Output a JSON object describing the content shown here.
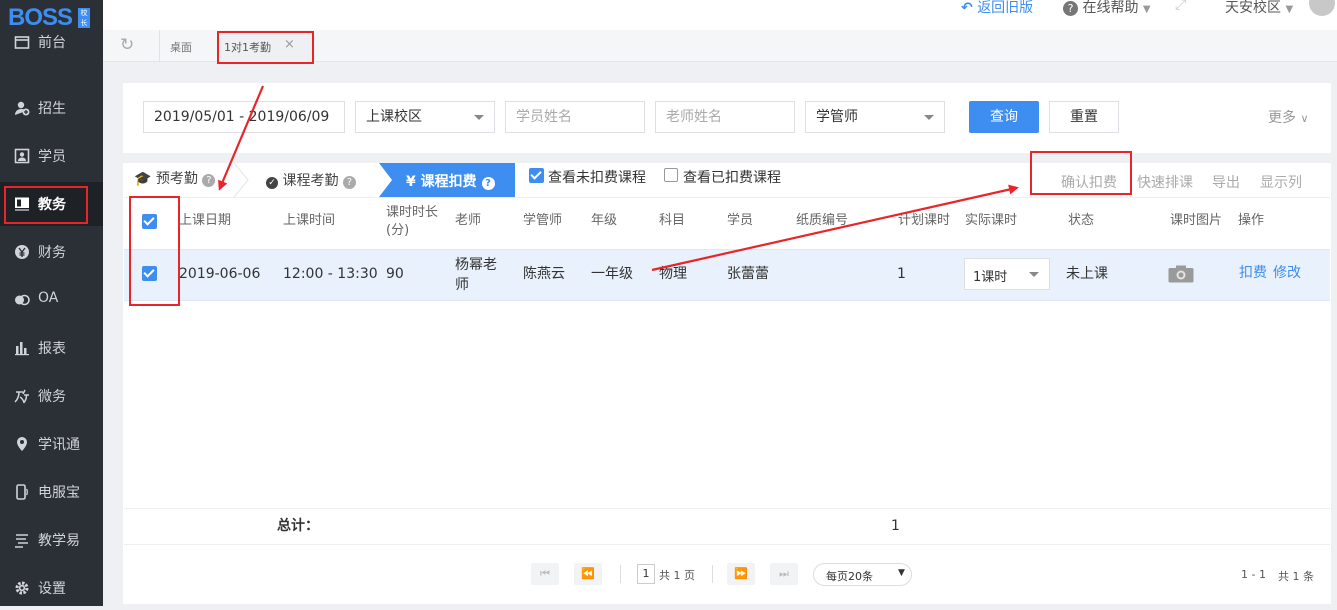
{
  "app": {
    "brand": "BOSS",
    "brand_badge": "校长"
  },
  "sidebar": {
    "items": [
      {
        "label": "前台",
        "icon": "calendar-icon"
      },
      {
        "label": "招生",
        "icon": "add-user-icon"
      },
      {
        "label": "学员",
        "icon": "student-card-icon"
      },
      {
        "label": "教务",
        "icon": "book-icon"
      },
      {
        "label": "财务",
        "icon": "yen-icon"
      },
      {
        "label": "OA",
        "icon": "oa-icon"
      },
      {
        "label": "报表",
        "icon": "bar-chart-icon"
      },
      {
        "label": "微务",
        "icon": "weiwu-icon"
      },
      {
        "label": "学讯通",
        "icon": "location-pin-icon"
      },
      {
        "label": "电服宝",
        "icon": "phone-icon"
      },
      {
        "label": "教学易",
        "icon": "teach-icon"
      },
      {
        "label": "设置",
        "icon": "gear-icon"
      }
    ],
    "active": "教务"
  },
  "topbar": {
    "back_label": "返回旧版",
    "help_label": "在线帮助",
    "campus_label": "天安校区"
  },
  "tabs": {
    "home_label": "桌面",
    "active_label": "1对1考勤"
  },
  "filters": {
    "date_range": "2019/05/01 - 2019/06/09",
    "campus_select": "上课校区",
    "student_placeholder": "学员姓名",
    "teacher_placeholder": "老师姓名",
    "manager_select": "学管师",
    "search_label": "查询",
    "reset_label": "重置",
    "more_label": "更多"
  },
  "steps": {
    "pre": "预考勤",
    "attendance": "课程考勤",
    "deduct": "¥ 课程扣费"
  },
  "view_options": {
    "unpaid_label": "查看未扣费课程",
    "unpaid_checked": true,
    "paid_label": "查看已扣费课程",
    "paid_checked": false
  },
  "toolbar": {
    "confirm": "确认扣费",
    "quick_schedule": "快速排课",
    "export": "导出",
    "columns": "显示列"
  },
  "table": {
    "headers": {
      "date": "上课日期",
      "time": "上课时间",
      "duration": "课时时长(分)",
      "teacher": "老师",
      "manager": "学管师",
      "grade": "年级",
      "subject": "科目",
      "student": "学员",
      "paper_no": "纸质编号",
      "planned": "计划课时",
      "actual": "实际课时",
      "status": "状态",
      "photo": "课时图片",
      "ops": "操作"
    },
    "rows": [
      {
        "date": "2019-06-06",
        "time": "12:00 - 13:30",
        "duration": "90",
        "teacher": "杨幂老师",
        "manager": "陈燕云",
        "grade": "一年级",
        "subject": "物理",
        "student": "张蕾蕾",
        "paper_no": "",
        "planned": "1",
        "actual": "1课时",
        "status": "未上课",
        "op_deduct": "扣费",
        "op_edit": "修改"
      }
    ],
    "total_label": "总计：",
    "total_planned": "1"
  },
  "pager": {
    "page": "1",
    "total_pages": "共 1 页",
    "page_size": "每页20条",
    "range": "1 - 1",
    "total_items": "共 1 条"
  },
  "colors": {
    "accent": "#3d8ef0",
    "annotation": "#e8262a",
    "sidebar_bg": "#2b2f36"
  }
}
